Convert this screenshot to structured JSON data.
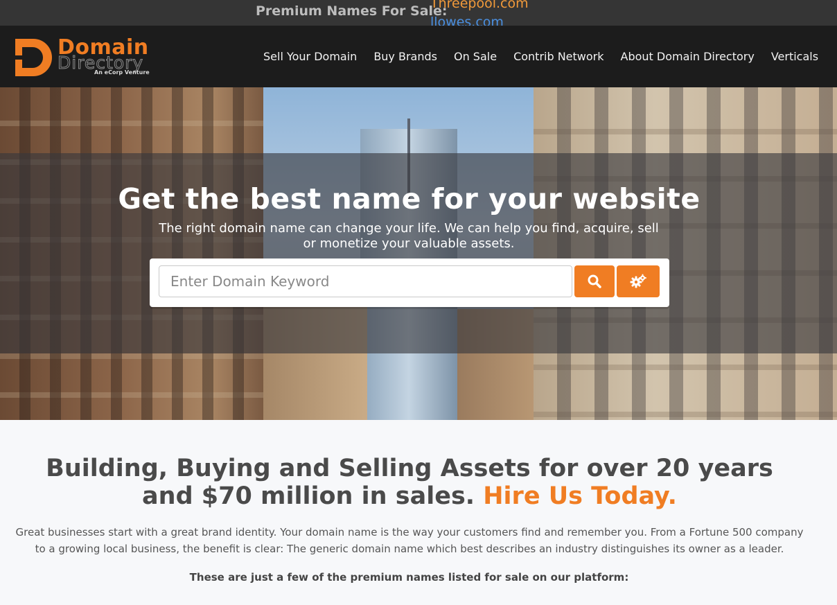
{
  "ticker": {
    "label": "Premium Names For Sale:",
    "names": [
      "Threepool.com",
      "llowes.com"
    ]
  },
  "header": {
    "logo": {
      "word1": "Domain",
      "word2": "Directory",
      "tagline": "An eCorp Venture"
    },
    "nav": [
      "Sell Your Domain",
      "Buy Brands",
      "On Sale",
      "Contrib Network",
      "About Domain Directory",
      "Verticals"
    ]
  },
  "hero": {
    "title": "Get the best name for your website",
    "subtitle": "The right domain name can change your life. We can help you find, acquire, sell or monetize your valuable assets.",
    "search": {
      "placeholder": "Enter Domain Keyword",
      "search_icon": "search-icon",
      "advanced_icon": "gears-icon"
    }
  },
  "content": {
    "headline_main": "Building, Buying and Selling Assets for over 20 years and $70 million in sales. ",
    "headline_highlight": "Hire Us Today.",
    "paragraph": "Great businesses start with a great brand identity. Your domain name is the way your customers find and remember you. From a Fortune 500 company to a growing local business, the benefit is clear: The generic domain name which best describes an industry distinguishes its owner as a leader.",
    "few_names_label": "These are just a few of the premium names listed for sale on our platform:"
  },
  "colors": {
    "accent": "#f07d23",
    "header_bg": "#1c1c1c",
    "ticker_bg": "#353535"
  }
}
